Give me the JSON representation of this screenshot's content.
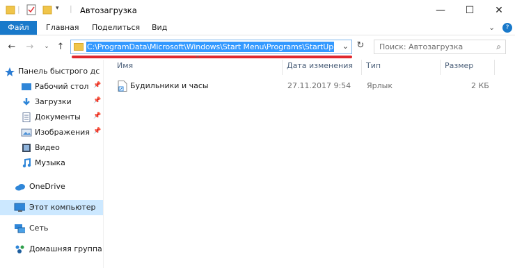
{
  "window": {
    "title": "Автозагрузка",
    "controls": {
      "minimize": "—",
      "maximize": "☐",
      "close": "✕"
    }
  },
  "ribbon": {
    "tabs": [
      "Файл",
      "Главная",
      "Поделиться",
      "Вид"
    ],
    "collapse_symbol": "⌄",
    "help_symbol": "?"
  },
  "nav": {
    "back": "←",
    "forward": "→",
    "recent": "⌄",
    "up": "↑"
  },
  "address": {
    "path": "C:\\ProgramData\\Microsoft\\Windows\\Start Menu\\Programs\\StartUp",
    "dropdown": "⌄",
    "refresh": "↻"
  },
  "search": {
    "placeholder": "Поиск: Автозагрузка",
    "icon": "⌕"
  },
  "sidebar": {
    "quick_access": "Панель быстрого дс",
    "items": [
      {
        "label": "Рабочий стол",
        "pinned": "📌",
        "icon": "desktop-icon"
      },
      {
        "label": "Загрузки",
        "pinned": "📌",
        "icon": "download-icon"
      },
      {
        "label": "Документы",
        "pinned": "📌",
        "icon": "documents-icon"
      },
      {
        "label": "Изображения",
        "pinned": "📌",
        "icon": "images-icon"
      },
      {
        "label": "Видео",
        "icon": "video-icon"
      },
      {
        "label": "Музыка",
        "icon": "music-icon"
      }
    ],
    "onedrive": "OneDrive",
    "this_pc": "Этот компьютер",
    "network": "Сеть",
    "homegroup": "Домашняя группа"
  },
  "columns": {
    "name": "Имя",
    "date": "Дата изменения",
    "type": "Тип",
    "size": "Размер"
  },
  "files": [
    {
      "name": "Будильники и часы",
      "date": "27.11.2017 9:54",
      "type": "Ярлык",
      "size": "2 КБ"
    }
  ],
  "colors": {
    "file_tab": "#1979ca",
    "selection": "#3399ff",
    "highlight_underline": "#e0282e",
    "selected_nav": "#cce8ff"
  }
}
